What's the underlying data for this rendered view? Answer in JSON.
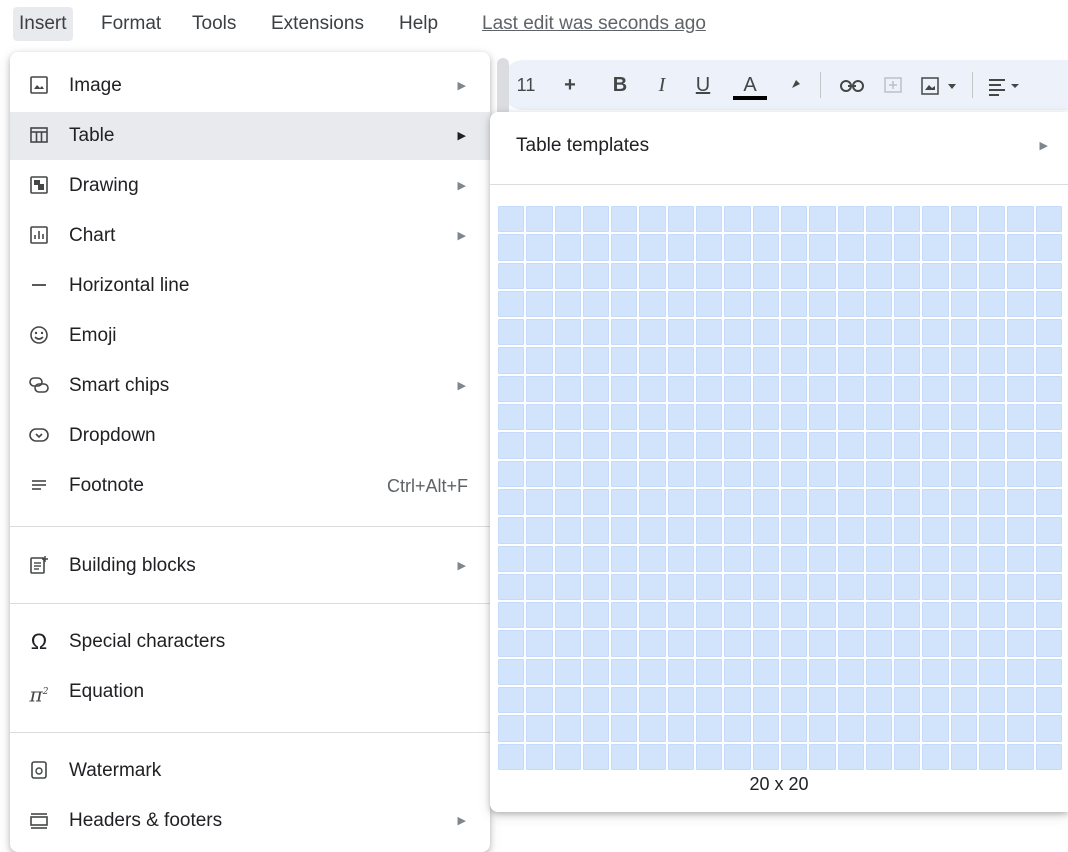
{
  "menubar": {
    "items": [
      "Insert",
      "Format",
      "Tools",
      "Extensions",
      "Help"
    ],
    "last_edit": "Last edit was seconds ago"
  },
  "toolbar": {
    "font_size": "11",
    "plus": "+",
    "bold": "B",
    "italic": "I",
    "underline": "U",
    "text_color": "A"
  },
  "insert_menu": {
    "items": [
      {
        "label": "Image",
        "icon": "image-icon",
        "submenu": true
      },
      {
        "label": "Table",
        "icon": "table-icon",
        "submenu": true
      },
      {
        "label": "Drawing",
        "icon": "drawing-icon",
        "submenu": true
      },
      {
        "label": "Chart",
        "icon": "chart-icon",
        "submenu": true
      },
      {
        "label": "Horizontal line",
        "icon": "horizontal-line-icon"
      },
      {
        "label": "Emoji",
        "icon": "emoji-icon"
      },
      {
        "label": "Smart chips",
        "icon": "smart-chips-icon",
        "submenu": true
      },
      {
        "label": "Dropdown",
        "icon": "dropdown-icon"
      },
      {
        "label": "Footnote",
        "icon": "footnote-icon",
        "shortcut": "Ctrl+Alt+F"
      },
      {
        "label": "Building blocks",
        "icon": "building-blocks-icon",
        "submenu": true
      },
      {
        "label": "Special characters",
        "icon": "omega-icon"
      },
      {
        "label": "Equation",
        "icon": "pi-icon"
      },
      {
        "label": "Watermark",
        "icon": "watermark-icon"
      },
      {
        "label": "Headers & footers",
        "icon": "headers-footers-icon",
        "submenu": true
      }
    ]
  },
  "table_submenu": {
    "templates_label": "Table templates",
    "grid_rows": 20,
    "grid_cols": 20,
    "grid_size_label": "20 x 20"
  },
  "colors": {
    "highlight": "#e8eaed",
    "grid_cell": "#d2e3fc",
    "toolbar_bg": "#edf2fa"
  }
}
